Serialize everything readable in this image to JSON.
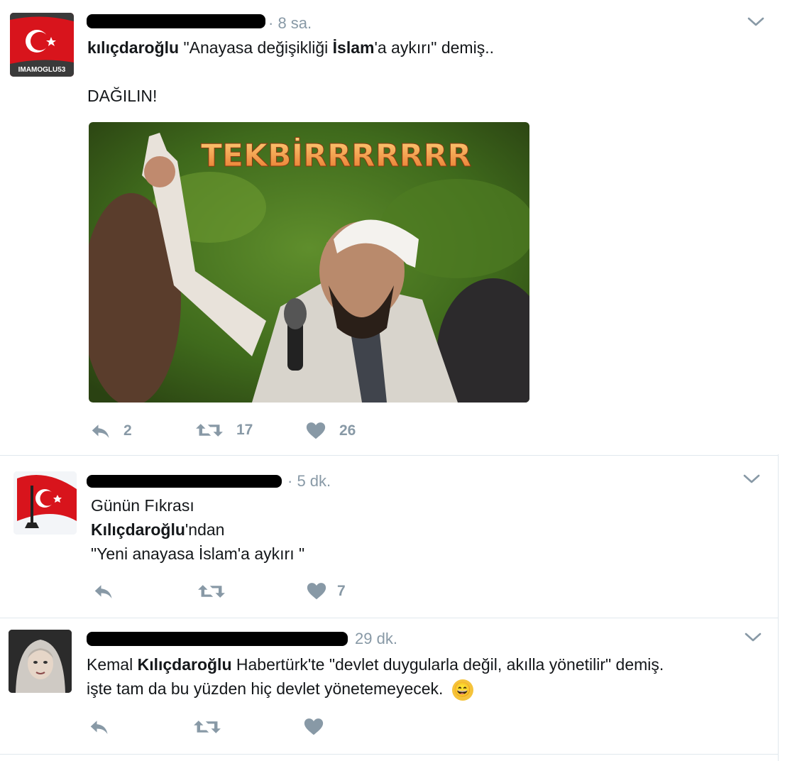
{
  "colors": {
    "accent_red": "#e30a17",
    "meta_gray": "#8899a6",
    "border": "#e1e8ed"
  },
  "tweets": [
    {
      "avatar_label": "IMAMOGLU53",
      "time": "· 8 sa.",
      "line1_bold1": "kılıçdaroğlu",
      "line1_mid": " \"Anayasa değişikliği ",
      "line1_bold2": "İslam",
      "line1_end": "'a aykırı\" demiş..",
      "line2": "DAĞILIN!",
      "media_caption": "TEKBİRRRRRRR",
      "reply_count": "2",
      "retweet_count": "17",
      "like_count": "26",
      "icons": [
        "reply-icon",
        "retweet-icon",
        "heart-icon",
        "chevron-down-icon"
      ]
    },
    {
      "time": "· 5 dk.",
      "line1": "Günün Fıkrası",
      "line2_bold": "Kılıçdaroğlu",
      "line2_end": "'ndan",
      "line3": "\"Yeni anayasa İslam'a aykırı \"",
      "like_count": "7",
      "icons": [
        "reply-icon",
        "retweet-icon",
        "heart-icon",
        "chevron-down-icon"
      ]
    },
    {
      "time": "29 dk.",
      "line1_a": "Kemal ",
      "line1_bold": "Kılıçdaroğlu",
      "line1_b": " Habertürk'te \"devlet duygularla değil, akılla yönetilir\" demiş.",
      "line2": "işte tam da bu yüzden hiç devlet yönetemeyecek.",
      "emoji": "😄",
      "icons": [
        "reply-icon",
        "retweet-icon",
        "heart-icon",
        "chevron-down-icon"
      ]
    }
  ]
}
